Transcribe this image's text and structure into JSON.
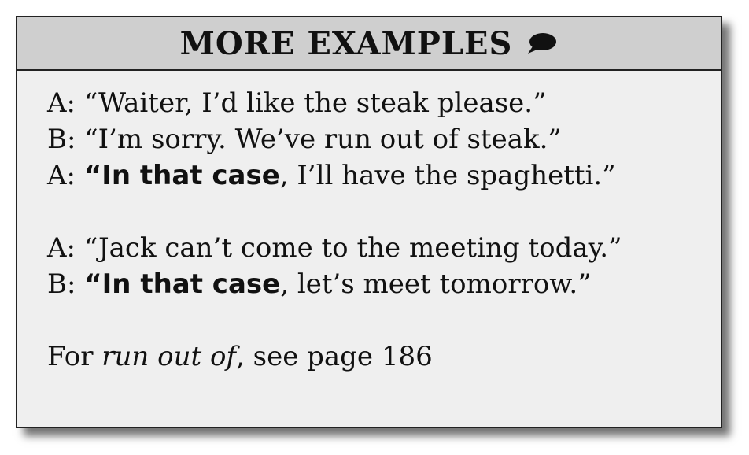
{
  "header": {
    "title": "MORE EXAMPLES",
    "icon": "speech-bubble-icon"
  },
  "dialogues": [
    {
      "lines": [
        {
          "speaker": "A:",
          "open": "“",
          "bold": "",
          "rest": "Waiter, I’d like the steak please.”"
        },
        {
          "speaker": "B:",
          "open": "“",
          "bold": "",
          "rest": "I’m sorry. We’ve run out of steak.”"
        },
        {
          "speaker": "A:",
          "open": "“",
          "bold": "In that case",
          "rest": ", I’ll have the spaghetti.”"
        }
      ]
    },
    {
      "lines": [
        {
          "speaker": "A:",
          "open": "“",
          "bold": "",
          "rest": "Jack can’t come to the meeting today.”"
        },
        {
          "speaker": "B:",
          "open": "“",
          "bold": "In that case",
          "rest": ", let’s meet tomorrow.”"
        }
      ]
    }
  ],
  "reference": {
    "prefix": "For ",
    "italic": "run out of",
    "suffix": ", see page 186"
  }
}
